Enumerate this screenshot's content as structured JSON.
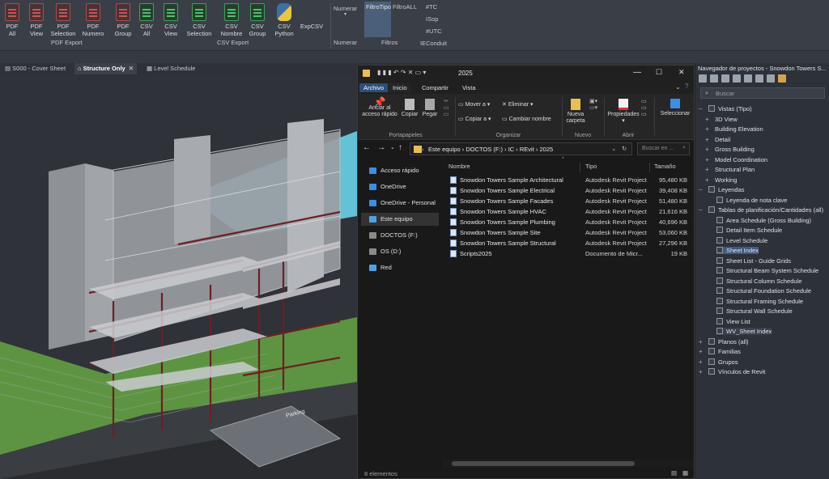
{
  "ribbon": {
    "buttons": [
      {
        "line1": "PDF",
        "line2": "All",
        "icon": "pdf-icon"
      },
      {
        "line1": "PDF",
        "line2": "View",
        "icon": "pdf-icon"
      },
      {
        "line1": "PDF",
        "line2": "Selection",
        "icon": "pdf-icon"
      },
      {
        "line1": "PDF",
        "line2": "Numero",
        "icon": "pdf-icon"
      },
      {
        "line1": "PDF",
        "line2": "Group",
        "icon": "pdf-icon"
      },
      {
        "line1": "CSV",
        "line2": "All",
        "icon": "csv-icon"
      },
      {
        "line1": "CSV",
        "line2": "View",
        "icon": "csv-icon"
      },
      {
        "line1": "CSV",
        "line2": "Selection",
        "icon": "csv-icon"
      },
      {
        "line1": "CSV",
        "line2": "Nombre",
        "icon": "csv-icon"
      },
      {
        "line1": "CSV",
        "line2": "Group",
        "icon": "csv-icon"
      },
      {
        "line1": "CSV",
        "line2": "Python",
        "icon": "python-icon"
      },
      {
        "line1": "ExpCSV",
        "line2": "",
        "icon": "expcsv-icon"
      }
    ],
    "groups": {
      "pdf": "PDF Export",
      "csv": "CSV Export",
      "numerar": "Numerar",
      "filtros": "Filtros"
    },
    "numerar_button": "Numerar",
    "filtro_tipo": "FiltroTipo",
    "filtro_all": "FiltroALL",
    "filter_items": [
      "#TC",
      "ISop",
      "#UTC",
      "IEConduit"
    ]
  },
  "view_tabs": [
    {
      "label": "S000 - Cover Sheet",
      "active": false
    },
    {
      "label": "Structure Only",
      "active": true
    },
    {
      "label": "Level Schedule",
      "active": false
    }
  ],
  "scene": {
    "parking_label": "Parking"
  },
  "explorer": {
    "title": "2025",
    "tabs": [
      "Archivo",
      "Inicio",
      "Compartir",
      "Vista"
    ],
    "ribbon": {
      "pin": "Anclar al acceso rápido",
      "copy": "Copiar",
      "paste": "Pegar",
      "move_to": "Mover a",
      "copy_to": "Copiar a",
      "delete": "Eliminar",
      "rename": "Cambiar nombre",
      "new_folder": "Nueva carpeta",
      "properties": "Propiedades",
      "select": "Seleccionar",
      "group_clipboard": "Portapapeles",
      "group_organize": "Organizar",
      "group_new": "Nuevo",
      "group_open": "Abrir"
    },
    "address": [
      "Este equipo",
      "DOCTOS (F:)",
      "IC",
      "REvit",
      "2025"
    ],
    "search_placeholder": "Buscar en ...",
    "nav": [
      {
        "label": "Acceso rápido",
        "icon": "star-icon",
        "color": "#3a8ee6"
      },
      {
        "label": "OneDrive",
        "icon": "cloud-icon",
        "color": "#3a8ee6"
      },
      {
        "label": "OneDrive - Personal",
        "icon": "cloud-icon",
        "color": "#3a8ee6"
      },
      {
        "label": "Este equipo",
        "icon": "computer-icon",
        "color": "#4aa3e8"
      },
      {
        "label": "DOCTOS (F:)",
        "icon": "drive-icon",
        "color": "#8a8a8a"
      },
      {
        "label": "OS (D:)",
        "icon": "drive-icon",
        "color": "#8a8a8a"
      },
      {
        "label": "Red",
        "icon": "network-icon",
        "color": "#4aa3e8"
      }
    ],
    "columns": [
      "Nombre",
      "Tipo",
      "Tamaño"
    ],
    "files": [
      {
        "name": "Snowdon Towers Sample Architectural",
        "type": "Autodesk Revit Project",
        "size": "95,480 KB"
      },
      {
        "name": "Snowdon Towers Sample Electrical",
        "type": "Autodesk Revit Project",
        "size": "39,408 KB"
      },
      {
        "name": "Snowdon Towers Sample Facades",
        "type": "Autodesk Revit Project",
        "size": "51,480 KB"
      },
      {
        "name": "Snowdon Towers Sample HVAC",
        "type": "Autodesk Revit Project",
        "size": "21,616 KB"
      },
      {
        "name": "Snowdon Towers Sample Plumbing",
        "type": "Autodesk Revit Project",
        "size": "40,696 KB"
      },
      {
        "name": "Snowdon Towers Sample Site",
        "type": "Autodesk Revit Project",
        "size": "53,060 KB"
      },
      {
        "name": "Snowdon Towers Sample Structural",
        "type": "Autodesk Revit Project",
        "size": "27,296 KB"
      },
      {
        "name": "Scripts2025",
        "type": "Documento de Micr...",
        "size": "19 KB"
      }
    ],
    "status": "8 elementos"
  },
  "browser": {
    "title": "Navegador de proyectos - Snowdon Towers S...",
    "search_placeholder": "Buscar",
    "tree": [
      {
        "label": "Vistas (Tipo)",
        "level": 0,
        "toggle": "−",
        "icon": "views-icon"
      },
      {
        "label": "3D View",
        "level": 1,
        "toggle": "+"
      },
      {
        "label": "Building Elevation",
        "level": 1,
        "toggle": "+"
      },
      {
        "label": "Detail",
        "level": 1,
        "toggle": "+"
      },
      {
        "label": "Gross Building",
        "level": 1,
        "toggle": "+"
      },
      {
        "label": "Model Coordination",
        "level": 1,
        "toggle": "+"
      },
      {
        "label": "Structural Plan",
        "level": 1,
        "toggle": "+"
      },
      {
        "label": "Working",
        "level": 1,
        "toggle": "+"
      },
      {
        "label": "Leyendas",
        "level": 0,
        "toggle": "−",
        "icon": "legend-icon"
      },
      {
        "label": "Leyenda de nota clave",
        "level": 2,
        "toggle": ""
      },
      {
        "label": "Tablas de planificación/Cantidades (all)",
        "level": 0,
        "toggle": "−",
        "icon": "schedule-icon"
      },
      {
        "label": "Area Schedule (Gross Building)",
        "level": 2,
        "toggle": ""
      },
      {
        "label": "Detail Item Schedule",
        "level": 2,
        "toggle": ""
      },
      {
        "label": "Level Schedule",
        "level": 2,
        "toggle": ""
      },
      {
        "label": "Sheet Index",
        "level": 2,
        "toggle": "",
        "highlight": true
      },
      {
        "label": "Sheet List - Guide Grids",
        "level": 2,
        "toggle": ""
      },
      {
        "label": "Structural Beam System Schedule",
        "level": 2,
        "toggle": ""
      },
      {
        "label": "Structural Column Schedule",
        "level": 2,
        "toggle": ""
      },
      {
        "label": "Structural Foundation Schedule",
        "level": 2,
        "toggle": ""
      },
      {
        "label": "Structural Framing Schedule",
        "level": 2,
        "toggle": ""
      },
      {
        "label": "Structural Wall Schedule",
        "level": 2,
        "toggle": ""
      },
      {
        "label": "View List",
        "level": 2,
        "toggle": ""
      },
      {
        "label": "WV_Sheet Index",
        "level": 2,
        "toggle": "",
        "selected": true
      },
      {
        "label": "Planos (all)",
        "level": 0,
        "toggle": "+",
        "icon": "sheets-icon"
      },
      {
        "label": "Familias",
        "level": 0,
        "toggle": "+",
        "icon": "families-icon"
      },
      {
        "label": "Grupos",
        "level": 0,
        "toggle": "+",
        "icon": "groups-icon"
      },
      {
        "label": "Vínculos de Revit",
        "level": 0,
        "toggle": "+",
        "icon": "link-icon"
      }
    ]
  }
}
